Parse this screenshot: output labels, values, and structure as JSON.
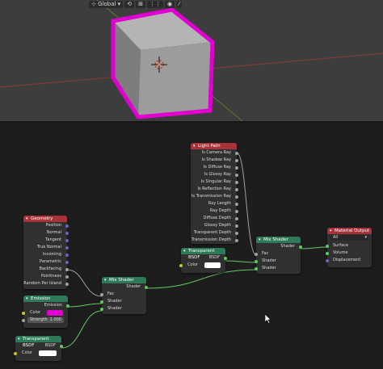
{
  "viewport": {
    "toolbar": {
      "orientation_label": "Global"
    },
    "colors": {
      "cube_face": "#9c9c9c",
      "cube_outline": "#e000d0",
      "selection": "#ff8c1a",
      "background": "#3d3d3d"
    }
  },
  "nodes": {
    "light_path": {
      "title": "Light Path",
      "outputs": [
        "Is Camera Ray",
        "Is Shadow Ray",
        "Is Diffuse Ray",
        "Is Glossy Ray",
        "Is Singular Ray",
        "Is Reflection Ray",
        "Is Transmission Ray",
        "Ray Length",
        "Ray Depth",
        "Diffuse Depth",
        "Glossy Depth",
        "Transparent Depth",
        "Transmission Depth"
      ]
    },
    "material_output": {
      "title": "Material Output",
      "target": "All",
      "inputs": [
        "Surface",
        "Volume",
        "Displacement"
      ]
    },
    "geometry": {
      "title": "Geometry",
      "outputs": [
        "Position",
        "Normal",
        "Tangent",
        "True Normal",
        "Incoming",
        "Parametric",
        "Backfacing",
        "Pointiness",
        "Random Per Island"
      ]
    },
    "mix_shader_right": {
      "title": "Mix Shader",
      "output": "Shader",
      "inputs": [
        "Fac",
        "Shader",
        "Shader"
      ]
    },
    "mix_shader_left": {
      "title": "Mix Shader",
      "output": "Shader",
      "inputs": [
        "Fac",
        "Shader",
        "Shader"
      ]
    },
    "transparent_bsdf_1": {
      "title": "Transparent BSDF",
      "output": "BSDF",
      "color_label": "Color",
      "color_value": "#ffffff"
    },
    "transparent_bsdf_2": {
      "title": "Transparent BSDF",
      "output": "BSDF",
      "color_label": "Color",
      "color_value": "#ffffff"
    },
    "emission": {
      "title": "Emission",
      "output": "Emission",
      "color_label": "Color",
      "color_value": "#e000d0",
      "strength_label": "Strength",
      "strength_value": "1.000"
    }
  }
}
